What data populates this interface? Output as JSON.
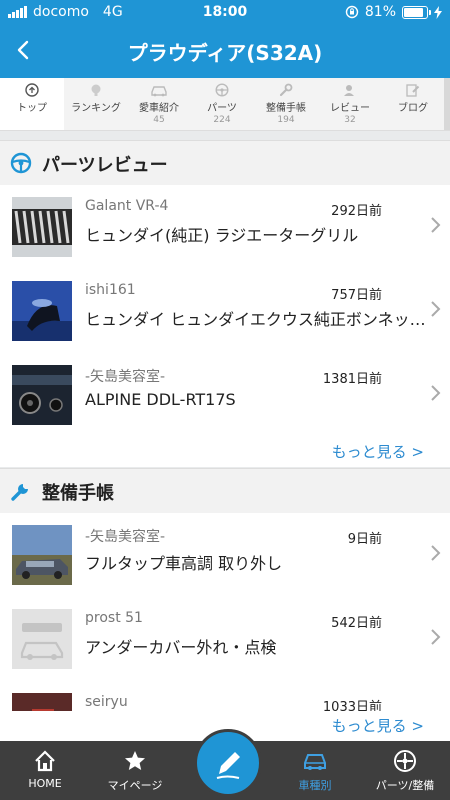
{
  "status_bar": {
    "carrier": "docomo",
    "network": "4G",
    "time": "18:00",
    "battery_pct": "81%"
  },
  "header": {
    "title": "プラウディア(S32A)"
  },
  "tabs": [
    {
      "label": "トップ",
      "count": ""
    },
    {
      "label": "ランキング",
      "count": ""
    },
    {
      "label": "愛車紹介",
      "count": "45"
    },
    {
      "label": "パーツ",
      "count": "224"
    },
    {
      "label": "整備手帳",
      "count": "194"
    },
    {
      "label": "レビュー",
      "count": "32"
    },
    {
      "label": "ブログ",
      "count": ""
    }
  ],
  "parts_review": {
    "title": "パーツレビュー",
    "items": [
      {
        "user": "Galant VR-4",
        "date": "292日前",
        "name": "ヒュンダイ(純正) ラジエーターグリル"
      },
      {
        "user": "ishi161",
        "date": "757日前",
        "name": "ヒュンダイ ヒュンダイエクウス純正ボンネットマスコット"
      },
      {
        "user": "-矢島美容室-",
        "date": "1381日前",
        "name": "ALPINE DDL-RT17S"
      }
    ],
    "more": "もっと見る >"
  },
  "maintenance": {
    "title": "整備手帳",
    "items": [
      {
        "user": "-矢島美容室-",
        "date": "9日前",
        "name": "フルタップ車高調 取り外し"
      },
      {
        "user": "prost 51",
        "date": "542日前",
        "name": "アンダーカバー外れ・点検"
      },
      {
        "user": "seiryu",
        "date": "1033日前",
        "name": ""
      }
    ],
    "more": "もっと見る >"
  },
  "bottom_nav": {
    "home": "HOME",
    "mypage": "マイページ",
    "car": "車種別",
    "parts": "パーツ/整備"
  },
  "colors": {
    "brand_blue": "#1f95d5",
    "link_blue": "#2d8bd0",
    "bottom_bar": "#3e3e3e"
  }
}
